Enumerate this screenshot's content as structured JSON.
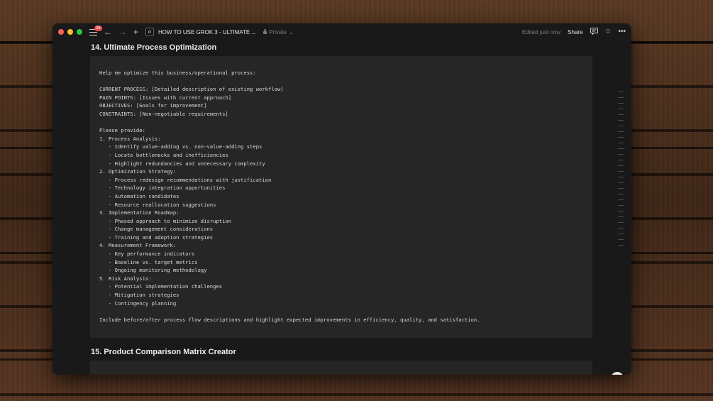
{
  "titlebar": {
    "notification_count": "26",
    "doc_title": "HOW TO USE GROK 3 - ULTIMATE ...",
    "privacy": "Private",
    "edited": "Edited just now",
    "share_label": "Share"
  },
  "sections": [
    {
      "heading": "14. Ultimate Process Optimization",
      "code": "Help me optimize this business/operational process:\n\nCURRENT PROCESS: [Detailed description of existing workflow]\nPAIN POINTS: [Issues with current approach]\nOBJECTIVES: [Goals for improvement]\nCONSTRAINTS: [Non-negotiable requirements]\n\nPlease provide:\n1. Process Analysis:\n   - Identify value-adding vs. non-value-adding steps\n   - Locate bottlenecks and inefficiencies\n   - Highlight redundancies and unnecessary complexity\n2. Optimization Strategy:\n   - Process redesign recommendations with justification\n   - Technology integration opportunities\n   - Automation candidates\n   - Resource reallocation suggestions\n3. Implementation Roadmap:\n   - Phased approach to minimize disruption\n   - Change management considerations\n   - Training and adoption strategies\n4. Measurement Framework:\n   - Key performance indicators\n   - Baseline vs. target metrics\n   - Ongoing monitoring methodology\n5. Risk Analysis:\n   - Potential implementation challenges\n   - Mitigation strategies\n   - Contingency planning\n\nInclude before/after process flow descriptions and highlight expected improvements in efficiency, quality, and satisfaction."
    },
    {
      "heading": "15. Product Comparison Matrix Creator",
      "code": ""
    }
  ],
  "help_glyph": "?",
  "colors": {
    "window_bg": "#191919",
    "code_bg": "#262626",
    "text": "#d8d8d8",
    "badge": "#e5484d"
  }
}
